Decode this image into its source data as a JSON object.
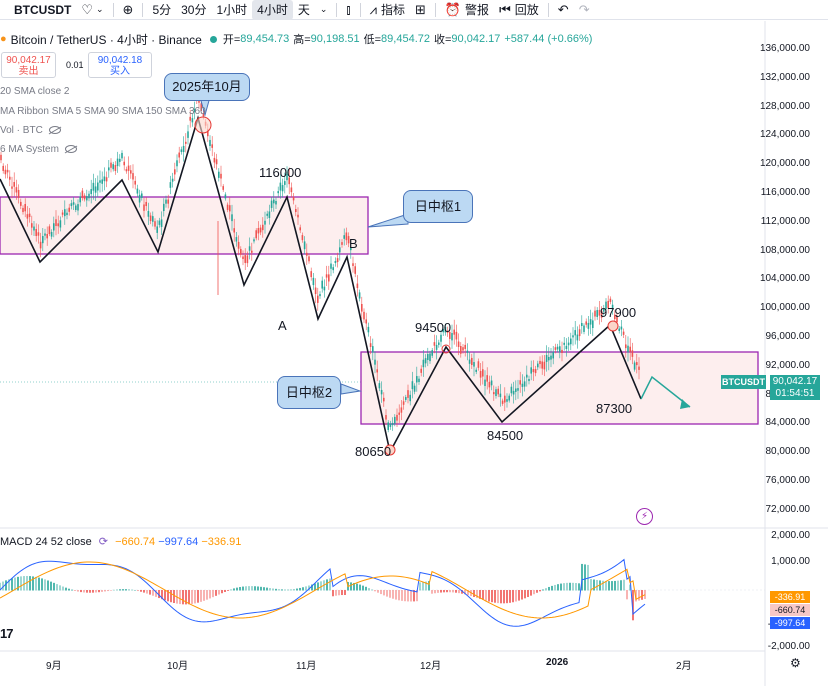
{
  "toolbar": {
    "symbol": "BTCUSDT",
    "heart_icon": "heart-icon",
    "intervals": [
      "5分",
      "30分",
      "1小时",
      "4小时",
      "天"
    ],
    "active_interval": "4小时",
    "indicators_label": "指标",
    "alert_label": "警报",
    "replay_label": "回放"
  },
  "legend": {
    "title": "Bitcoin / TetherUS · 4小时 · Binance",
    "open_label": "开=",
    "open": "89,454.73",
    "high_label": "高=",
    "high": "90,198.51",
    "low_label": "低=",
    "low": "89,454.72",
    "close_label": "收=",
    "close": "90,042.17",
    "change": "+587.44 (+0.66%)"
  },
  "trade": {
    "sell_price": "90,042.17",
    "sell_label": "卖出",
    "qty": "0.01",
    "buy_price": "90,042.18",
    "buy_label": "买入"
  },
  "indicators": [
    "20 SMA close 2",
    "MA Ribbon SMA 5 SMA 90 SMA 150 SMA 360",
    "Vol · BTC",
    "6 MA System"
  ],
  "annotations": {
    "oct_label": "2025年10月",
    "zone1_label": "日中枢1",
    "zone2_label": "日中枢2",
    "p116000": "116000",
    "label_a": "A",
    "label_b": "B",
    "p94500": "94500",
    "p97900": "97900",
    "p87300": "87300",
    "p84500": "84500",
    "p80650": "80650"
  },
  "y_axis": [
    "136,000.00",
    "132,000.00",
    "128,000.00",
    "124,000.00",
    "120,000.00",
    "116,000.00",
    "112,000.00",
    "108,000.00",
    "104,000.00",
    "100,000.00",
    "96,000.00",
    "92,000.00",
    "88,000.00",
    "84,000.00",
    "80,000.00",
    "76,000.00",
    "72,000.00"
  ],
  "macd_axis": [
    "2,000.00",
    "1,000.00",
    "-1,000.00",
    "-2,000.00"
  ],
  "x_axis": [
    "9月",
    "10月",
    "11月",
    "12月",
    "2026",
    "2月"
  ],
  "price_tags": {
    "symbol_tag": "BTCUSDT",
    "last_price": "90,042.17",
    "countdown": "01:54:51"
  },
  "macd": {
    "title": "MACD 24 52 close",
    "hist": "−660.74",
    "macd": "−997.64",
    "signal": "−336.91",
    "tag_signal": "-336.91",
    "tag_hist": "-660.74",
    "tag_macd": "-997.64"
  },
  "colors": {
    "up": "#26a69a",
    "down": "#ef5350",
    "zone_border": "#9c27b0",
    "zone_fill": "#fdeeee",
    "macd_line": "#2962ff",
    "signal_line": "#ff9800",
    "bubble_fill": "#bcd9f3"
  }
}
